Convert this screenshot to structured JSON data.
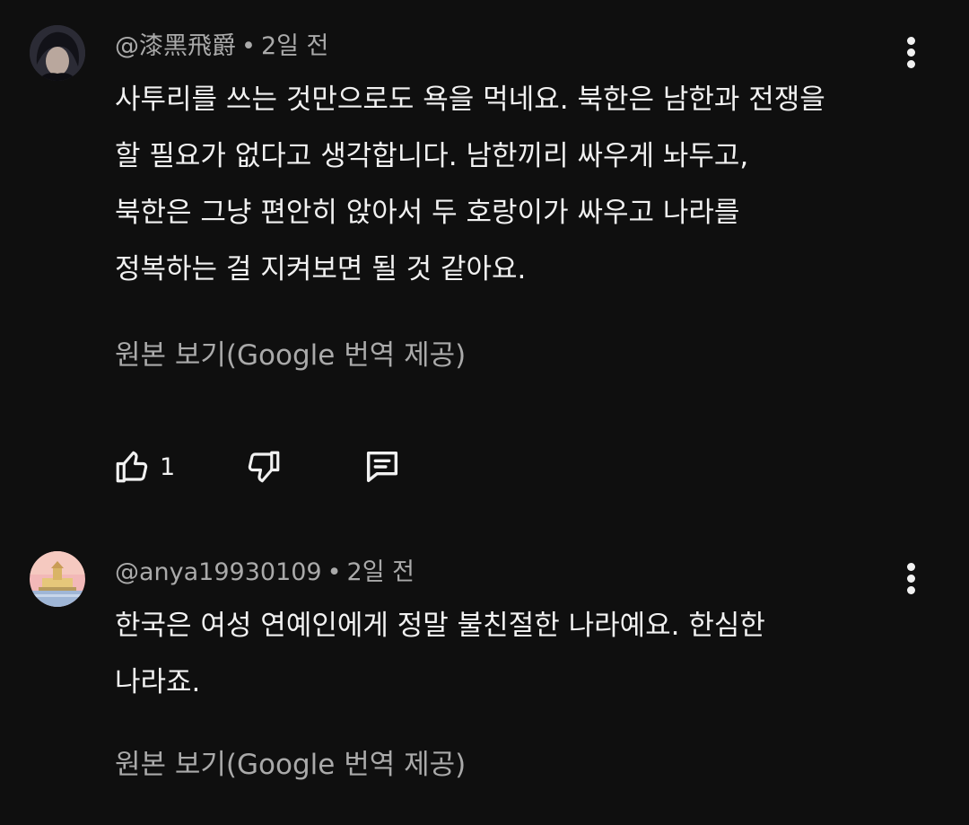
{
  "comments": [
    {
      "author": "@漆黑飛爵",
      "time": "2일 전",
      "lines": [
        "사투리를 쓰는 것만으로도 욕을 먹네요. 북한은 남한과 전쟁을",
        "할 필요가 없다고 생각합니다. 남한끼리 싸우게 놔두고,",
        "북한은 그냥 편안히 앉아서 두 호랑이가 싸우고 나라를",
        "정복하는 걸 지켜보면 될 것 같아요."
      ],
      "translate_link": "원본 보기(Google 번역 제공)",
      "like_count": "1",
      "avatar_colors": {
        "bg": "#2b2b35",
        "hair": "#121218",
        "face": "#b9a79d"
      }
    },
    {
      "author": "@anya19930109",
      "time": "2일 전",
      "lines": [
        "한국은 여성 연예인에게 정말 불친절한 나라예요. 한심한",
        "나라죠."
      ],
      "translate_link": "원본 보기(Google 번역 제공)",
      "avatar_colors": {
        "sky": "#f2b8b8",
        "building": "#e6c77a",
        "ground": "#9fb6d6"
      }
    }
  ],
  "separator_dot": "•",
  "icons": {
    "like": "thumb-up-icon",
    "dislike": "thumb-down-icon",
    "reply": "comment-reply-icon",
    "menu": "more-vertical-icon"
  }
}
